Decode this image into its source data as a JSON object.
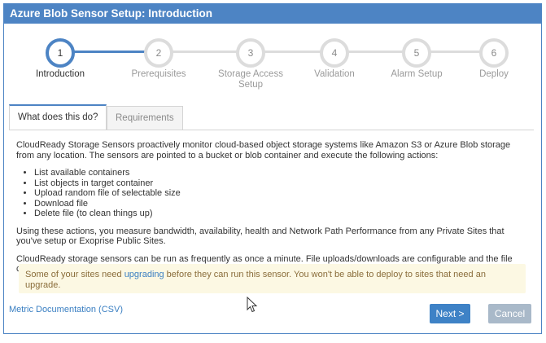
{
  "window": {
    "title": "Azure Blob Sensor Setup: Introduction"
  },
  "wizard": {
    "current_step": 1,
    "steps": [
      {
        "number": "1",
        "label": "Introduction"
      },
      {
        "number": "2",
        "label": "Prerequisites"
      },
      {
        "number": "3",
        "label": "Storage Access Setup"
      },
      {
        "number": "4",
        "label": "Validation"
      },
      {
        "number": "5",
        "label": "Alarm Setup"
      },
      {
        "number": "6",
        "label": "Deploy"
      }
    ]
  },
  "tabs": {
    "active": "What does this do?",
    "inactive": "Requirements"
  },
  "content": {
    "intro": "CloudReady Storage Sensors proactively monitor cloud-based object storage systems like Amazon S3 or Azure Blob storage from any location. The sensors are pointed to a bucket or blob container and execute the following actions:",
    "actions": [
      "List available containers",
      "List objects in target container",
      "Upload random file of selectable size",
      "Download file",
      "Delete file (to clean things up)"
    ],
    "para2": "Using these actions, you measure bandwidth, availability, health and Network Path Performance from any Private Sites that you've setup or Exoprise Public Sites.",
    "para3": "CloudReady storage sensors can be run as frequently as once a minute. File uploads/downloads are configurable and the file can optionally be non-randomized or randomized."
  },
  "warning": {
    "before": "Some of your sites need ",
    "link": "upgrading",
    "after": " before they can run this sensor. You won't be able to deploy to sites that need an upgrade."
  },
  "footer": {
    "doc_link": "Metric Documentation (CSV)",
    "next_label": "Next >",
    "cancel_label": "Cancel"
  },
  "colors": {
    "accent": "#4d84c4",
    "warning_bg": "#fcf8e3",
    "warning_text": "#8a6d3b"
  }
}
